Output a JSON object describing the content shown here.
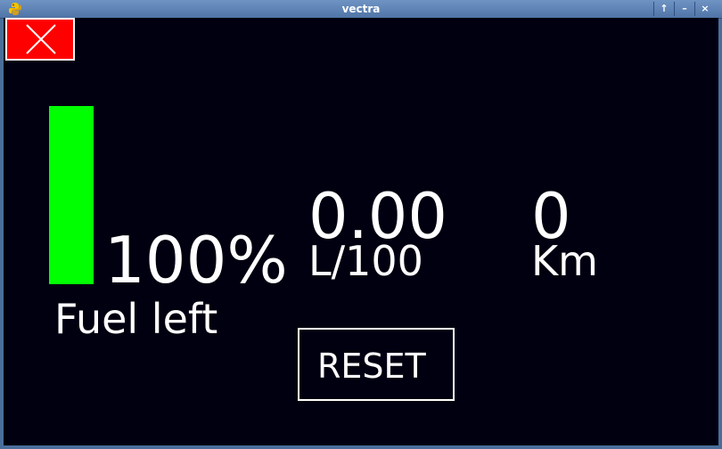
{
  "window": {
    "title": "vectra",
    "buttons": {
      "raise": "↑",
      "minimize": "–",
      "close": "×"
    }
  },
  "fuel": {
    "percent_text": "100%",
    "level_fraction": 1.0,
    "label": "Fuel left",
    "bar_color": "#00ff00"
  },
  "consumption": {
    "value": "0.00",
    "unit": "L/100"
  },
  "distance": {
    "value": "0",
    "unit": "Km"
  },
  "reset": {
    "label": "RESET"
  },
  "colors": {
    "background": "#000010",
    "close_button": "#ff0000",
    "text": "#ffffff"
  }
}
